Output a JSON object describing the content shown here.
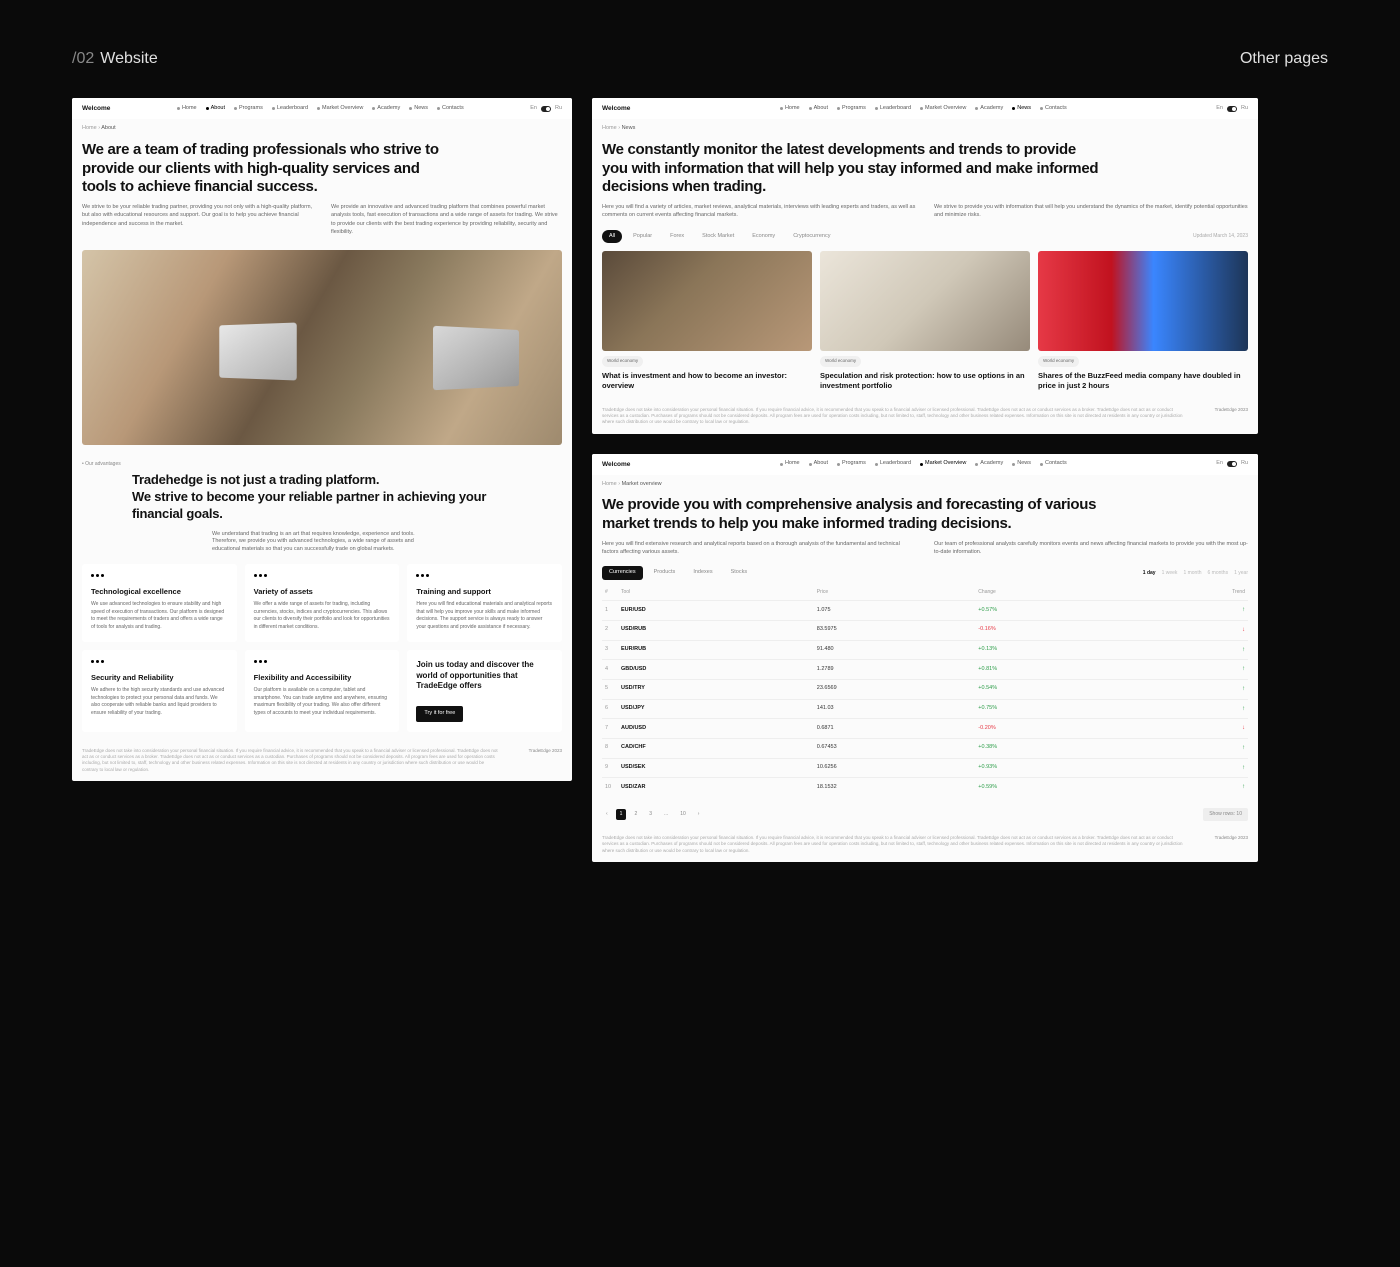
{
  "header": {
    "section_num": "/02",
    "section_label": "Website",
    "right_label": "Other pages"
  },
  "nav": {
    "brand": "Welcome",
    "items": [
      "Home",
      "About",
      "Programs",
      "Leaderboard",
      "Market Overview",
      "Academy",
      "News",
      "Contacts"
    ],
    "lang_en": "En",
    "lang_ru": "Ru"
  },
  "about": {
    "breadcrumb_home": "Home",
    "breadcrumb_current": "About",
    "active_nav": "About",
    "hero_title": "We are a team of trading professionals who strive to provide our clients with high-quality services and tools to achieve financial success.",
    "col1": "We strive to be your reliable trading partner, providing you not only with a high-quality platform, but also with educational resources and support. Our goal is to help you achieve financial independence and success in the market.",
    "col2": "We provide an innovative and advanced trading platform that combines powerful market analysis tools, fast execution of transactions and a wide range of assets for trading. We strive to provide our clients with the best trading experience by providing reliability, security and flexibility.",
    "section_label": "• Our advantages",
    "section_title_l1": "Tradehedge is not just a trading platform.",
    "section_title_l2": "We strive to become your reliable partner in achieving your financial goals.",
    "section_sub": "We understand that trading is an art that requires knowledge, experience and tools. Therefore, we provide you with advanced technologies, a wide range of assets and educational materials so that you can successfully trade on global markets.",
    "cards": [
      {
        "title": "Technological excellence",
        "text": "We use advanced technologies to ensure stability and high speed of execution of transactions. Our platform is designed to meet the requirements of traders and offers a wide range of tools for analysis and trading."
      },
      {
        "title": "Variety of assets",
        "text": "We offer a wide range of assets for trading, including currencies, stocks, indices and cryptocurrencies. This allows our clients to diversify their portfolio and look for opportunities in different market conditions."
      },
      {
        "title": "Training and support",
        "text": "Here you will find educational materials and analytical reports that will help you improve your skills and make informed decisions. The support service is always ready to answer your questions and provide assistance if necessary."
      },
      {
        "title": "Security and Reliability",
        "text": "We adhere to the high security standards and use advanced technologies to protect your personal data and funds. We also cooperate with reliable banks and liquid providers to ensure reliability of your trading."
      },
      {
        "title": "Flexibility and Accessibility",
        "text": "Our platform is available on a computer, tablet and smartphone. You can trade anytime and anywhere, ensuring maximum flexibility of your trading. We also offer different types of accounts to meet your individual requirements."
      }
    ],
    "cta_title": "Join us today and discover the world of opportunities that TradeEdge offers",
    "cta_button": "Try it for free"
  },
  "news": {
    "breadcrumb_home": "Home",
    "breadcrumb_current": "News",
    "active_nav": "News",
    "hero_title": "We constantly monitor the latest developments and trends to provide you with information that will help you stay informed and make informed decisions when trading.",
    "col1": "Here you will find a variety of articles, market reviews, analytical materials, interviews with leading experts and traders, as well as comments on current events affecting financial markets.",
    "col2": "We strive to provide you with information that will help you understand the dynamics of the market, identify potential opportunities and minimize risks.",
    "filters": [
      "All",
      "Popular",
      "Forex",
      "Stock Market",
      "Economy",
      "Cryptocurrency"
    ],
    "updated": "Updated March 14, 2023",
    "articles": [
      {
        "tag": "World economy",
        "title": "What is investment and how to become an investor: overview"
      },
      {
        "tag": "World economy",
        "title": "Speculation and risk protection: how to use options in an investment portfolio"
      },
      {
        "tag": "World economy",
        "title": "Shares of the BuzzFeed media company have doubled in price in just 2 hours"
      }
    ]
  },
  "market": {
    "breadcrumb_home": "Home",
    "breadcrumb_current": "Market overview",
    "active_nav": "Market Overview",
    "hero_title": "We provide you with comprehensive analysis and forecasting of various market trends to help you make informed trading decisions.",
    "col1": "Here you will find extensive research and analytical reports based on a thorough analysis of the fundamental and technical factors affecting various assets.",
    "col2": "Our team of professional analysts carefully monitors events and news affecting financial markets to provide you with the most up-to-date information.",
    "tabs": [
      "Currencies",
      "Products",
      "Indexes",
      "Stocks"
    ],
    "time_tabs": [
      "1 day",
      "1 week",
      "1 month",
      "6 months",
      "1 year"
    ],
    "headers": {
      "num": "#",
      "tool": "Tool",
      "price": "Price",
      "change": "Change",
      "trend": "Trend"
    },
    "rows": [
      {
        "n": "1",
        "tool": "EUR/USD",
        "price": "1.075",
        "change": "+0.57%",
        "dir": "pos"
      },
      {
        "n": "2",
        "tool": "USD/RUB",
        "price": "83.5975",
        "change": "-0.16%",
        "dir": "neg"
      },
      {
        "n": "3",
        "tool": "EUR/RUB",
        "price": "91.480",
        "change": "+0.13%",
        "dir": "pos"
      },
      {
        "n": "4",
        "tool": "GBD/USD",
        "price": "1.2789",
        "change": "+0.81%",
        "dir": "pos"
      },
      {
        "n": "5",
        "tool": "USD/TRY",
        "price": "23.6569",
        "change": "+0.54%",
        "dir": "pos"
      },
      {
        "n": "6",
        "tool": "USD/JPY",
        "price": "141.03",
        "change": "+0.75%",
        "dir": "pos"
      },
      {
        "n": "7",
        "tool": "AUD/USD",
        "price": "0.6871",
        "change": "-0.20%",
        "dir": "neg"
      },
      {
        "n": "8",
        "tool": "CAD/CHF",
        "price": "0.67453",
        "change": "+0.38%",
        "dir": "pos"
      },
      {
        "n": "9",
        "tool": "USD/SEK",
        "price": "10.6256",
        "change": "+0.93%",
        "dir": "pos"
      },
      {
        "n": "10",
        "tool": "USD/ZAR",
        "price": "18.1532",
        "change": "+0.59%",
        "dir": "pos"
      }
    ],
    "pagination": {
      "pages": [
        "1",
        "2",
        "3",
        "...",
        "10"
      ],
      "show_rows": "Show rows: 10"
    }
  },
  "footer": {
    "disclaimer": "TradeEdge does not take into consideration your personal financial situation. If you require financial advice, it is recommended that you speak to a financial adviser or licensed professional. TradeEdge does not act as or conduct services as a broker. TradeEdge does not act as or conduct services as a custodian. Purchases of programs should not be considered deposits. All program fees are used for operation costs including, but not limited to, staff, technology and other business related expenses. Information on this site is not directed at residents in any country or jurisdiction where such distribution or use would be contrary to local law or regulation.",
    "copy": "TradeEdge 2023"
  }
}
